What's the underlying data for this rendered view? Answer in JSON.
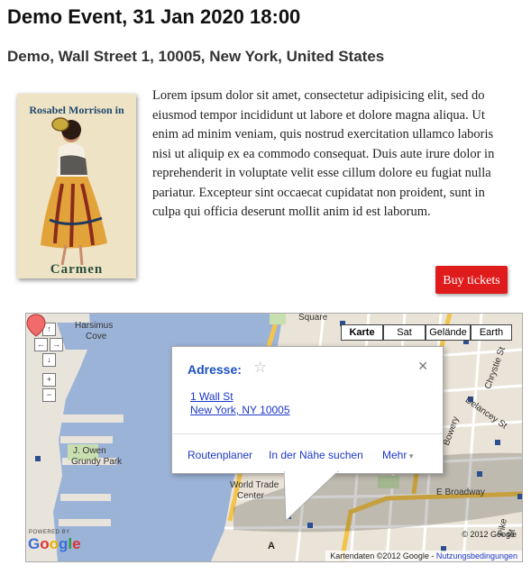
{
  "event": {
    "title": "Demo Event, 31 Jan 2020 18:00",
    "location": "Demo, Wall Street 1, 10005, New York, United States",
    "description": "Lorem ipsum dolor sit amet, consectetur adipisicing elit, sed do eiusmod tempor incididunt ut labore et dolore magna aliqua. Ut enim ad minim veniam, quis nostrud exercitation ullamco laboris nisi ut aliquip ex ea commodo consequat. Duis aute irure dolor in reprehenderit in voluptate velit esse cillum dolore eu fugiat nulla pariatur. Excepteur sint occaecat cupidatat non proident, sunt in culpa qui officia deserunt mollit anim id est laborum.",
    "buy_label": "Buy tickets"
  },
  "poster": {
    "top_text": "Rosabel Morrison in",
    "bottom_text": "Carmen"
  },
  "map": {
    "pan": {
      "up": "↑",
      "left": "←",
      "right": "→",
      "down": "↓"
    },
    "zoom": {
      "in": "+",
      "out": "−"
    },
    "types": [
      "Karte",
      "Sat",
      "Gelände",
      "Earth"
    ],
    "active_type": "Karte",
    "labels": {
      "square": "Square",
      "harsimus": "Harsimus",
      "cove": "Cove",
      "owen": "J. Owen",
      "grundy": "Grundy Park",
      "wtc1": "World Trade",
      "wtc2": "Center",
      "broadway": "E Broadway",
      "delancey": "Delancey St",
      "chrystie": "Chrystie St",
      "bowery": "Bowery",
      "pike": "Pike St"
    },
    "info": {
      "title": "Adresse:",
      "star": "☆",
      "close": "✕",
      "address_line1": "1 Wall St",
      "address_line2": "New York, NY 10005",
      "route": "Routenplaner",
      "nearby": "In der Nähe suchen",
      "more": "Mehr"
    },
    "marker": "A",
    "copyright": "© 2012 Google",
    "attribution": "Kartendaten ©2012 Google",
    "terms": "Nutzungsbedingungen",
    "powered_by": "POWERED BY",
    "google_logo": "Google",
    "colors": {
      "water": "#9cb3d8",
      "land": "#eae3d7",
      "highway": "#f2c44b",
      "link": "#1c38c8",
      "buy_button": "#e01b1b"
    }
  }
}
